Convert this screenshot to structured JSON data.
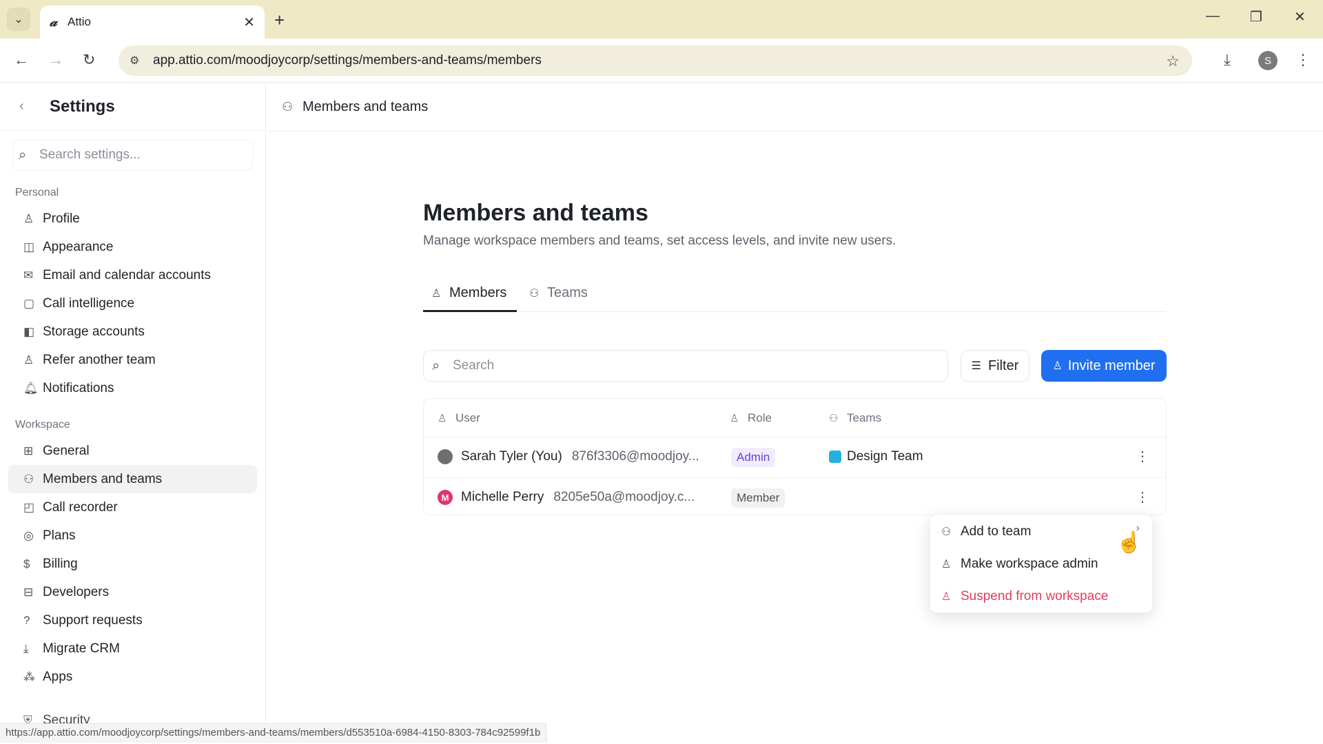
{
  "browser": {
    "tab_title": "Attio",
    "tab_favicon": "𝒶",
    "url": "app.attio.com/moodjoycorp/settings/members-and-teams/members",
    "profile_initial": "S",
    "status_url": "https://app.attio.com/moodjoycorp/settings/members-and-teams/members/d553510a-6984-4150-8303-784c92599f1b"
  },
  "sidebar": {
    "title": "Settings",
    "search_placeholder": "Search settings...",
    "personal_label": "Personal",
    "personal_items": [
      {
        "label": "Profile",
        "icon": "user-icon"
      },
      {
        "label": "Appearance",
        "icon": "appearance-icon"
      },
      {
        "label": "Email and calendar accounts",
        "icon": "mail-icon"
      },
      {
        "label": "Call intelligence",
        "icon": "call-intelligence-icon"
      },
      {
        "label": "Storage accounts",
        "icon": "storage-icon"
      },
      {
        "label": "Refer another team",
        "icon": "refer-icon"
      },
      {
        "label": "Notifications",
        "icon": "bell-icon"
      }
    ],
    "workspace_label": "Workspace",
    "workspace_items": [
      {
        "label": "General",
        "icon": "grid-icon"
      },
      {
        "label": "Members and teams",
        "icon": "users-icon"
      },
      {
        "label": "Call recorder",
        "icon": "recorder-icon"
      },
      {
        "label": "Plans",
        "icon": "plans-icon"
      },
      {
        "label": "Billing",
        "icon": "dollar-icon"
      },
      {
        "label": "Developers",
        "icon": "developers-icon"
      },
      {
        "label": "Support requests",
        "icon": "help-icon"
      },
      {
        "label": "Migrate CRM",
        "icon": "download-icon"
      },
      {
        "label": "Apps",
        "icon": "apps-icon"
      },
      {
        "label": "Security",
        "icon": "security-icon"
      }
    ]
  },
  "header": {
    "title": "Members and teams"
  },
  "page": {
    "title": "Members and teams",
    "subtitle": "Manage workspace members and teams, set access levels, and invite new users.",
    "tabs": [
      {
        "label": "Members",
        "active": true
      },
      {
        "label": "Teams",
        "active": false
      }
    ],
    "search_placeholder": "Search",
    "filter_label": "Filter",
    "invite_label": "Invite member"
  },
  "table": {
    "columns": [
      "User",
      "Role",
      "Teams"
    ],
    "rows": [
      {
        "avatar": "",
        "avatar_color": "#6f6f6f",
        "name": "Sarah Tyler (You)",
        "email": "876f3306@moodjoy...",
        "role": "Admin",
        "team": "Design Team"
      },
      {
        "avatar": "M",
        "avatar_color": "#e0336f",
        "name": "Michelle Perry",
        "email": "8205e50a@moodjoy.c...",
        "role": "Member",
        "team": ""
      }
    ]
  },
  "context_menu": {
    "items": [
      {
        "label": "Add to team",
        "icon": "users-icon"
      },
      {
        "label": "Make workspace admin",
        "icon": "user-key-icon"
      },
      {
        "label": "Suspend from workspace",
        "icon": "user-suspend-icon"
      }
    ]
  },
  "colors": {
    "accent": "#1f6ff0",
    "danger": "#e23c5a",
    "admin_badge": "#6b3fd6"
  }
}
